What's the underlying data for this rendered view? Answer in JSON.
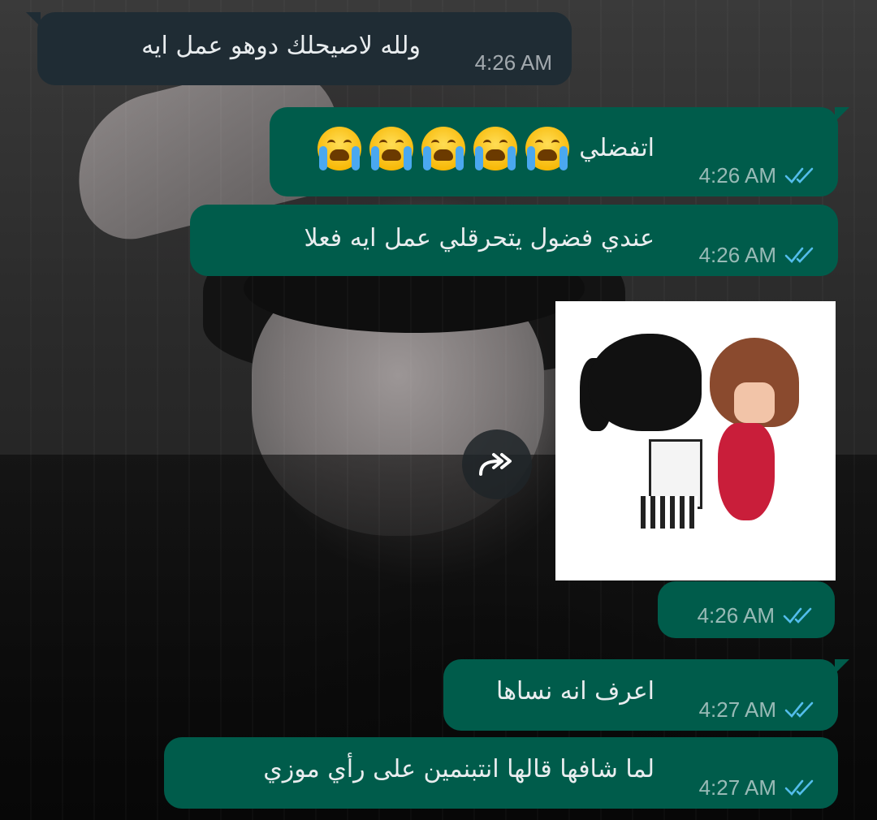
{
  "messages": [
    {
      "direction": "incoming",
      "text": "ولله لاصيحلك دوهو عمل ايه",
      "time": "4:26 AM"
    },
    {
      "direction": "outgoing",
      "text": "اتفضلي",
      "emoji": [
        "loudly-crying-face",
        "loudly-crying-face",
        "loudly-crying-face",
        "loudly-crying-face",
        "loudly-crying-face"
      ],
      "time": "4:26 AM",
      "status": "read"
    },
    {
      "direction": "outgoing",
      "text": "عندي فضول يتحرقلي عمل ايه فعلا",
      "time": "4:26 AM",
      "status": "read"
    },
    {
      "direction": "outgoing",
      "type": "sticker",
      "sticker": "couple-hug-sticker",
      "time": "4:26 AM",
      "status": "read"
    },
    {
      "direction": "outgoing",
      "text": "اعرف انه نساها",
      "time": "4:27 AM",
      "status": "read"
    },
    {
      "direction": "outgoing",
      "text": "لما شافها قالها انتبنمين على رأي موزي",
      "time": "4:27 AM",
      "status": "read"
    }
  ],
  "colors": {
    "incoming_bubble": "#1f2c34",
    "outgoing_bubble": "#005c4b",
    "read_tick": "#53bdeb",
    "text": "#e9edef"
  },
  "icons": {
    "forward": "forward-icon",
    "read_status": "double-check-icon"
  }
}
